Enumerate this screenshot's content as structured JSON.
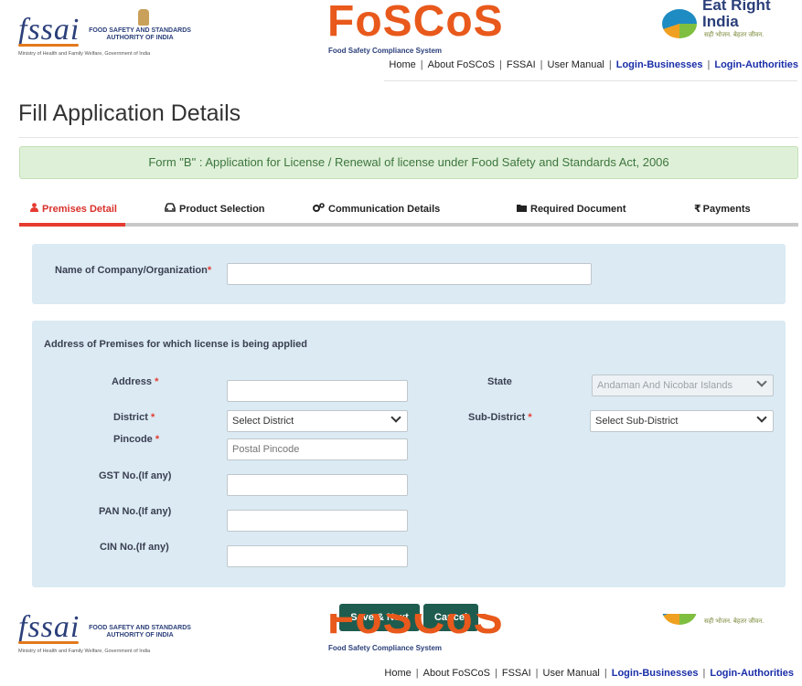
{
  "header": {
    "fssai_word": "fssai",
    "fssai_org_line1": "FOOD SAFETY AND STANDARDS",
    "fssai_org_line2": "AUTHORITY OF INDIA",
    "fssai_ministry": "Ministry of Health and Family Welfare, Government of India",
    "foscos_title": "FoSCoS",
    "foscos_subtitle": "Food Safety Compliance System",
    "eatright_line1": "Eat Right",
    "eatright_line2": "India",
    "eatright_tagline": "सही भोजन. बेहतर जीवन.",
    "nav": [
      "Home",
      "About FoSCoS",
      "FSSAI",
      "User Manual",
      "Login-Businesses",
      "Login-Authorities"
    ],
    "nav_separator": "|"
  },
  "page": {
    "title": "Fill Application Details",
    "form_banner": "Form \"B\" : Application for License / Renewal of license under Food Safety and Standards Act, 2006"
  },
  "tabs": [
    {
      "label": "Premises Detail",
      "icon": "user-icon",
      "active": true
    },
    {
      "label": "Product Selection",
      "icon": "car-icon",
      "active": false
    },
    {
      "label": "Communication Details",
      "icon": "gears-icon",
      "active": false
    },
    {
      "label": "Required Document",
      "icon": "folder-icon",
      "active": false
    },
    {
      "label": "Payments",
      "icon": "rupee-icon",
      "active": false
    }
  ],
  "company": {
    "label": "Name of Company/Organization",
    "required_mark": "*",
    "value": ""
  },
  "address_section": {
    "title": "Address of Premises for which license is being applied",
    "address_label": "Address",
    "address_value": "",
    "state_label": "State",
    "state_value": "Andaman And Nicobar Islands",
    "district_label": "District",
    "district_value": "Select District",
    "subdistrict_label": "Sub-District",
    "subdistrict_value": "Select Sub-District",
    "pincode_label": "Pincode",
    "pincode_placeholder": "Postal Pincode",
    "gst_label": "GST No.(If any)",
    "pan_label": "PAN No.(If any)",
    "cin_label": "CIN No.(If any)",
    "required_mark": "*"
  },
  "actions": {
    "save_next": "Save & Next",
    "cancel": "Cancel"
  },
  "colors": {
    "accent": "#e53b30",
    "button": "#1f5c50",
    "panel": "#dbeaf3",
    "banner": "#dff0d8",
    "nav_link": "#1a2ea8"
  }
}
